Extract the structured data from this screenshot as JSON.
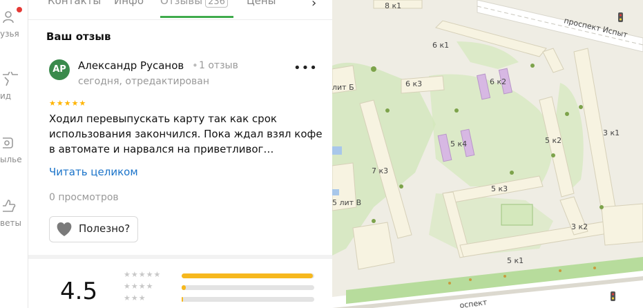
{
  "rail": {
    "items": [
      {
        "label": "узья",
        "icon": "people-icon"
      },
      {
        "label": "ид",
        "icon": "star-icon"
      },
      {
        "label": "ылье",
        "icon": "bag-icon"
      },
      {
        "label": "веты",
        "icon": "thumb-icon"
      }
    ]
  },
  "tabs": {
    "items": [
      {
        "label": "Контакты"
      },
      {
        "label": "Инфо"
      },
      {
        "label": "Отзывы",
        "count": "236"
      },
      {
        "label": "Цены"
      }
    ],
    "active_index": 2
  },
  "review": {
    "heading": "Ваш отзыв",
    "avatar_initials": "АР",
    "avatar_color": "#3a8a4c",
    "author": "Александр Русанов",
    "author_reviews": "1 отзыв",
    "date": "сегодня, отредактирован",
    "rating_stars": 5,
    "text": "Ходил перевыпускать карту так как срок использования закончился. Пока ждал взял кофе в автомате и нарвался на приветливог…",
    "read_more": "Читать целиком",
    "views": "0 просмотров",
    "useful_label": "Полезно?"
  },
  "summary": {
    "rating": "4.5",
    "distribution": [
      {
        "stars": 5,
        "fraction": 0.99
      },
      {
        "stars": 4,
        "fraction": 0.03
      },
      {
        "stars": 3,
        "fraction": 0.01
      }
    ],
    "bar_color": "#f6b81e"
  },
  "map": {
    "streets": [
      {
        "name": "проспект Испыт"
      },
      {
        "name": "оспект"
      }
    ],
    "buildings": [
      "8 к1",
      "6 к1",
      "6 к3",
      "6 к2",
      "5 к4",
      "5 к2",
      "3 к1",
      "7 к3",
      "5 к3",
      "3 к2",
      "5 к1",
      "лит Б",
      "5 лит В"
    ]
  }
}
